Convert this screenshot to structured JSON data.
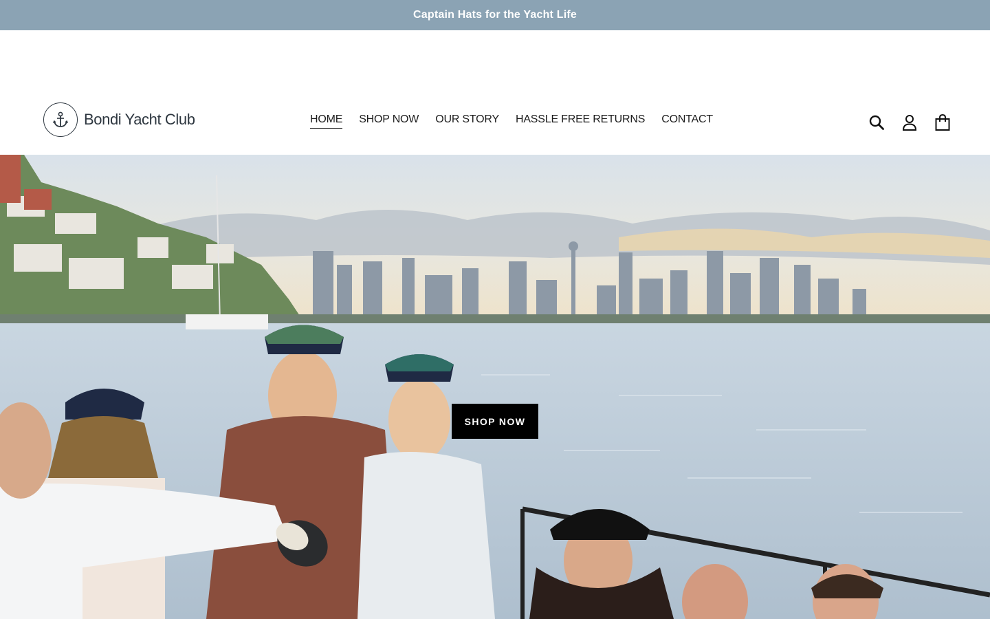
{
  "announcement": {
    "text": "Captain Hats for the Yacht Life"
  },
  "brand": {
    "name": "Bondi Yacht Club",
    "logo_icon": "anchor-icon"
  },
  "nav": {
    "items": [
      {
        "label": "HOME",
        "active": true
      },
      {
        "label": "SHOP NOW",
        "active": false
      },
      {
        "label": "OUR STORY",
        "active": false
      },
      {
        "label": "HASSLE FREE RETURNS",
        "active": false
      },
      {
        "label": "CONTACT",
        "active": false
      }
    ]
  },
  "header_icons": {
    "search": "search-icon",
    "account": "account-icon",
    "cart": "cart-icon"
  },
  "hero": {
    "button_label": "SHOP NOW",
    "image_description": "Friends in captain hats toasting champagne on a boat in Sydney Harbour"
  },
  "colors": {
    "announcement_bg": "#8ba3b4",
    "button_bg": "#000000",
    "text": "#1d1d1d"
  }
}
